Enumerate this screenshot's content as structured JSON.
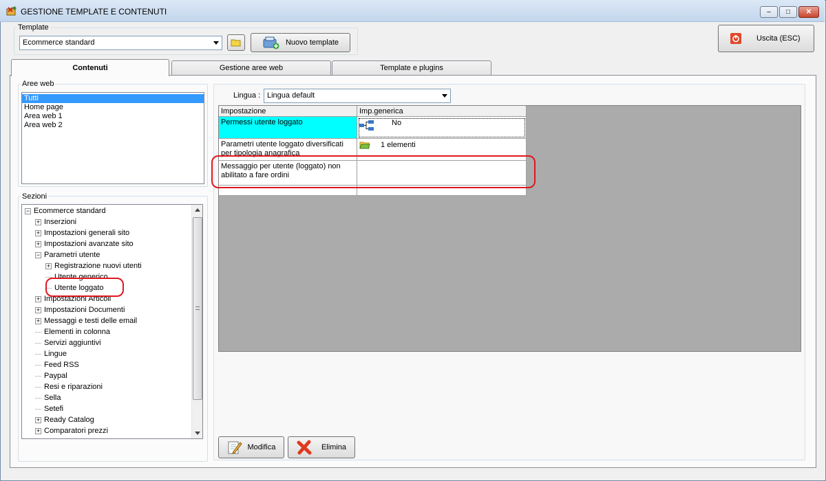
{
  "window": {
    "title": "GESTIONE TEMPLATE E CONTENUTI",
    "minimize_glyph": "–",
    "maximize_glyph": "□",
    "close_glyph": "✕"
  },
  "template_group": {
    "label": "Template",
    "selected": "Ecommerce standard",
    "new_template_label": "Nuovo template"
  },
  "exit_button": {
    "label": "Uscita (ESC)"
  },
  "tabs": [
    {
      "label": "Contenuti",
      "active": true
    },
    {
      "label": "Gestione aree web",
      "active": false
    },
    {
      "label": "Template e plugins",
      "active": false
    }
  ],
  "aree_web": {
    "label": "Aree web",
    "items": [
      "Tutti",
      "Home page",
      "Area web 1",
      "Area web 2"
    ],
    "selected_index": 0
  },
  "sezioni": {
    "label": "Sezioni",
    "tree": [
      {
        "label": "Ecommerce standard",
        "level": 0,
        "expander": "−"
      },
      {
        "label": "Inserzioni",
        "level": 1,
        "expander": "+"
      },
      {
        "label": "Impostazioni generali sito",
        "level": 1,
        "expander": "+"
      },
      {
        "label": "Impostazioni avanzate sito",
        "level": 1,
        "expander": "+"
      },
      {
        "label": "Parametri utente",
        "level": 1,
        "expander": "−"
      },
      {
        "label": "Registrazione nuovi utenti",
        "level": 2,
        "expander": "+"
      },
      {
        "label": "Utente generico",
        "level": 2,
        "expander": ""
      },
      {
        "label": "Utente loggato",
        "level": 2,
        "expander": "",
        "highlighted": true
      },
      {
        "label": "Impostazioni Articoli",
        "level": 1,
        "expander": "+"
      },
      {
        "label": "Impostazioni Documenti",
        "level": 1,
        "expander": "+"
      },
      {
        "label": "Messaggi e testi delle email",
        "level": 1,
        "expander": "+"
      },
      {
        "label": "Elementi in colonna",
        "level": 1,
        "expander": ""
      },
      {
        "label": "Servizi aggiuntivi",
        "level": 1,
        "expander": ""
      },
      {
        "label": "Lingue",
        "level": 1,
        "expander": ""
      },
      {
        "label": "Feed RSS",
        "level": 1,
        "expander": ""
      },
      {
        "label": "Paypal",
        "level": 1,
        "expander": ""
      },
      {
        "label": "Resi e riparazioni",
        "level": 1,
        "expander": ""
      },
      {
        "label": "Sella",
        "level": 1,
        "expander": ""
      },
      {
        "label": "Setefi",
        "level": 1,
        "expander": ""
      },
      {
        "label": "Ready Catalog",
        "level": 1,
        "expander": "+"
      },
      {
        "label": "Comparatori prezzi",
        "level": 1,
        "expander": "+"
      }
    ]
  },
  "lingua": {
    "label": "Lingua :",
    "selected": "Lingua default"
  },
  "grid": {
    "columns": [
      "Impostazione",
      "Imp.generica"
    ],
    "rows": [
      {
        "setting": "Permessi utente loggato",
        "value": "No",
        "icon": "network-icon",
        "selected": true
      },
      {
        "setting": "Parametri utente loggato diversificati per tipologia anagrafica",
        "value": "1 elementi",
        "icon": "folder-icon"
      },
      {
        "setting": "Messaggio per utente (loggato) non abilitato a fare ordini",
        "value": "",
        "highlighted": true
      }
    ]
  },
  "actions": {
    "edit_label": "Modifica",
    "delete_label": "Elimina"
  },
  "colors": {
    "selected_cell": "#00ffff",
    "highlight_ring": "#e0161e",
    "selection_blue": "#3399ff"
  }
}
